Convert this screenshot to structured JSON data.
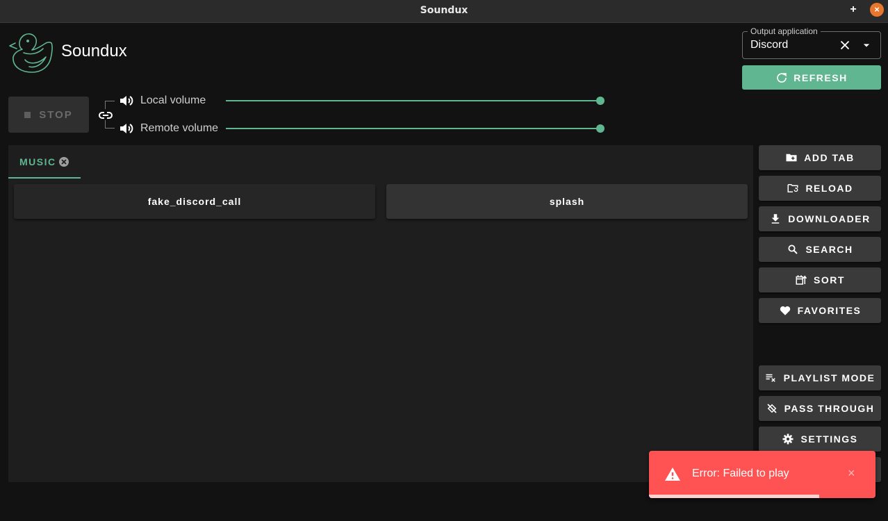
{
  "window": {
    "title": "Soundux",
    "add_symbol": "+",
    "close_symbol": "×"
  },
  "header": {
    "app_name": "Soundux"
  },
  "output": {
    "legend": "Output application",
    "value": "Discord",
    "refresh_label": "REFRESH"
  },
  "controls": {
    "stop_label": "STOP",
    "local_volume_label": "Local volume",
    "remote_volume_label": "Remote volume",
    "local_volume": 1.0,
    "remote_volume": 1.0
  },
  "tabs": [
    {
      "label": "MUSIC"
    }
  ],
  "sounds": [
    {
      "name": "fake_discord_call"
    },
    {
      "name": "splash"
    }
  ],
  "sidebar": {
    "add_tab": "ADD TAB",
    "reload": "RELOAD",
    "downloader": "DOWNLOADER",
    "search": "SEARCH",
    "sort": "SORT",
    "favorites": "FAVORITES",
    "playlist_mode": "PLAYLIST MODE",
    "pass_through": "PASS THROUGH",
    "settings": "SETTINGS"
  },
  "toast": {
    "message": "Error: Failed to play",
    "close_symbol": "×",
    "progress": 0.75
  },
  "colors": {
    "accent": "#5fb691",
    "error": "#ff5252",
    "background": "#121212"
  }
}
